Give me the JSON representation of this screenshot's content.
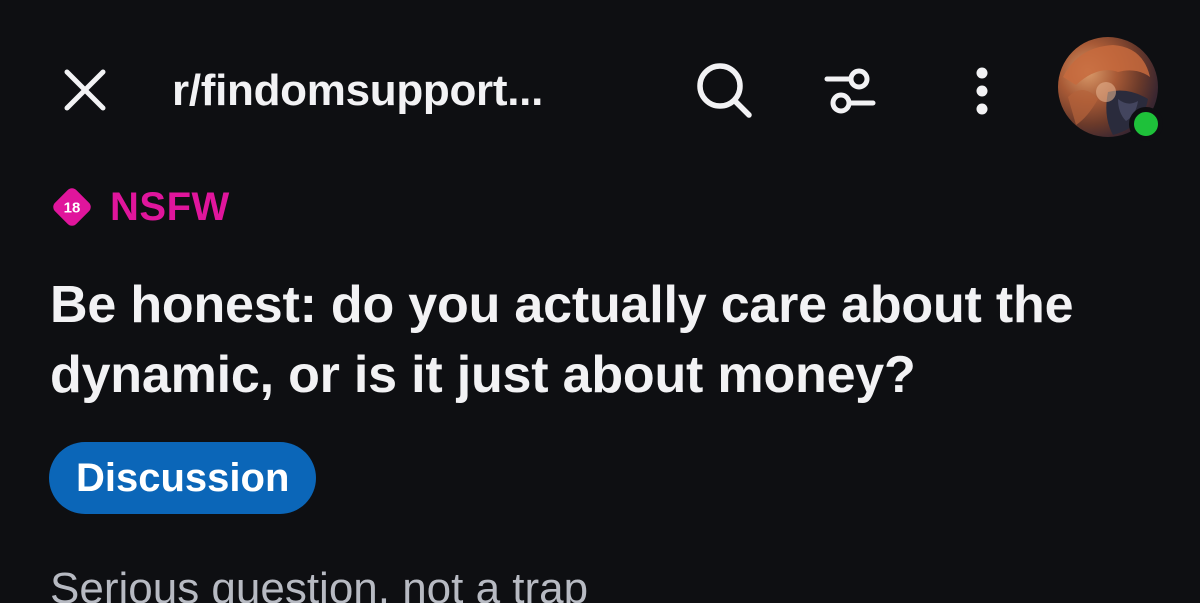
{
  "header": {
    "subreddit": "r/findomsupport...",
    "close_icon": "close-icon",
    "search_icon": "search-icon",
    "filter_icon": "sort-filter-icon",
    "more_icon": "more-vertical-icon",
    "avatar_status": "online"
  },
  "post": {
    "nsfw_badge_number": "18",
    "nsfw_label": "NSFW",
    "title": "Be honest: do you actually care about the dynamic, or is it just about money?",
    "flair": "Discussion",
    "body_preview": "Serious question, not a trap"
  },
  "colors": {
    "background": "#0e0f12",
    "nsfw": "#e0159c",
    "flair_bg": "#0b66b8",
    "online": "#1ec13a",
    "text": "#f2f2f4",
    "muted_text": "#b7bac2"
  }
}
